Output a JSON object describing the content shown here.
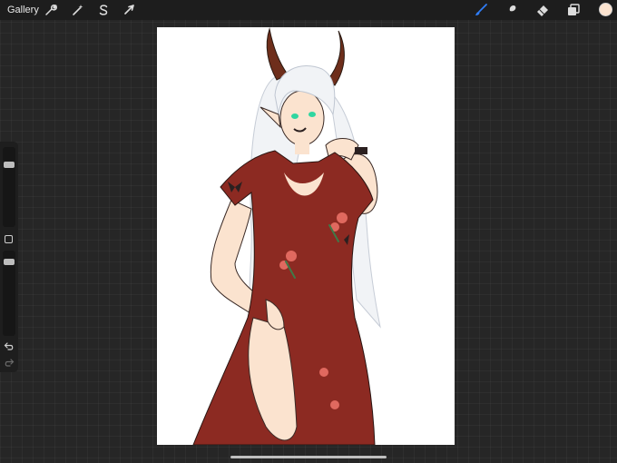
{
  "toolbar": {
    "gallery_label": "Gallery",
    "left_tools": [
      {
        "name": "actions",
        "icon": "wrench-icon"
      },
      {
        "name": "adjustments",
        "icon": "magic-wand-icon"
      },
      {
        "name": "selection",
        "icon": "selection-s-icon"
      },
      {
        "name": "transform",
        "icon": "arrow-cursor-icon"
      }
    ],
    "right_tools": [
      {
        "name": "brush",
        "icon": "brush-icon",
        "active": true
      },
      {
        "name": "smudge",
        "icon": "smudge-icon",
        "active": false
      },
      {
        "name": "eraser",
        "icon": "eraser-icon",
        "active": false
      },
      {
        "name": "layers",
        "icon": "layers-icon",
        "active": false
      }
    ],
    "current_color": "#fbe3cf",
    "active_tool_color": "#2f7df6",
    "icon_color": "#dcdcdc"
  },
  "sidebar": {
    "brush_size_level": 0.85,
    "opacity_level": 0.95,
    "undo_icon": "undo-icon",
    "redo_icon": "redo-icon"
  },
  "colors": {
    "background": "#262626",
    "toolbar": "#1d1d1d",
    "canvas": "#ffffff",
    "dress": "#8c2a22",
    "skin": "#fbe3cf",
    "hair": "#f1f3f6",
    "horns": "#6e2e1b",
    "eyes": "#2fd6a0",
    "roses": "#e0695f"
  }
}
